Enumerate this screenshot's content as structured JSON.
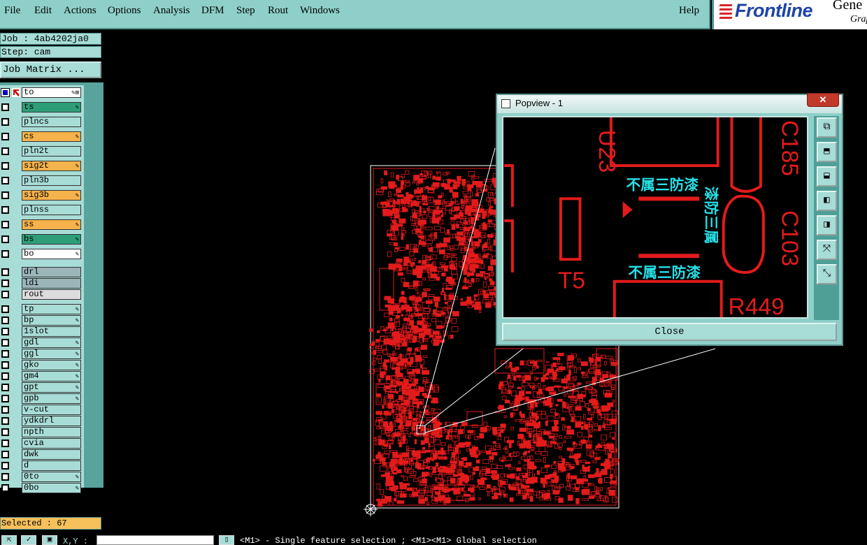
{
  "menu": {
    "items": [
      "File",
      "Edit",
      "Actions",
      "Options",
      "Analysis",
      "DFM",
      "Step",
      "Rout",
      "Windows"
    ],
    "help": "Help"
  },
  "brand": {
    "name": "Frontline",
    "product": "Gene",
    "sub": "Grap"
  },
  "job": {
    "label": "Job : 4ab4202ja0",
    "step": "Step: cam",
    "matrix_button": "Job Matrix ..."
  },
  "layers": [
    {
      "name": "to",
      "color": "white",
      "tag": "✎⊞"
    },
    {
      "name": "ts",
      "color": "green",
      "tag": "✎"
    },
    {
      "name": "plncs",
      "color": "teal",
      "tag": ""
    },
    {
      "name": "cs",
      "color": "orange",
      "tag": "✎"
    },
    {
      "name": "pln2t",
      "color": "teal",
      "tag": ""
    },
    {
      "name": "sig2t",
      "color": "orange",
      "tag": "✎"
    },
    {
      "name": "pln3b",
      "color": "teal",
      "tag": ""
    },
    {
      "name": "sig3b",
      "color": "orange",
      "tag": "✎"
    },
    {
      "name": "plnss",
      "color": "teal",
      "tag": ""
    },
    {
      "name": "ss",
      "color": "orange",
      "tag": "✎"
    },
    {
      "name": "bs",
      "color": "green",
      "tag": "✎"
    },
    {
      "name": "bo",
      "color": "white",
      "tag": "✎"
    },
    {
      "name": "drl",
      "color": "grey",
      "tag": ""
    },
    {
      "name": "ldi",
      "color": "grey",
      "tag": ""
    },
    {
      "name": "rout",
      "color": "lgrey",
      "tag": ""
    },
    {
      "name": "tp",
      "color": "teal",
      "tag": "✎"
    },
    {
      "name": "bp",
      "color": "teal",
      "tag": "✎"
    },
    {
      "name": "1slot",
      "color": "teal",
      "tag": ""
    },
    {
      "name": "gdl",
      "color": "teal",
      "tag": "✎"
    },
    {
      "name": "ggl",
      "color": "teal",
      "tag": "✎"
    },
    {
      "name": "gko",
      "color": "teal",
      "tag": "✎"
    },
    {
      "name": "gm4",
      "color": "teal",
      "tag": "✎"
    },
    {
      "name": "gpt",
      "color": "teal",
      "tag": "✎"
    },
    {
      "name": "gpb",
      "color": "teal",
      "tag": "✎"
    },
    {
      "name": "v-cut",
      "color": "teal",
      "tag": ""
    },
    {
      "name": "ydkdrl",
      "color": "teal",
      "tag": ""
    },
    {
      "name": "npth",
      "color": "teal",
      "tag": ""
    },
    {
      "name": "cvia",
      "color": "teal",
      "tag": ""
    },
    {
      "name": "dwk",
      "color": "teal",
      "tag": ""
    },
    {
      "name": "d",
      "color": "teal",
      "tag": ""
    },
    {
      "name": "0to",
      "color": "teal",
      "tag": "✎"
    },
    {
      "name": "0bo",
      "color": "teal",
      "tag": "✎"
    }
  ],
  "selected": "Selected : 67",
  "coords": {
    "label": "X,Y :",
    "value": ""
  },
  "status": "<M1> - Single feature selection ; <M1><M1> Global selection",
  "popview": {
    "title": "Popview - 1",
    "close_x": "✕",
    "close_button": "Close",
    "labels": [
      "U23",
      "C185",
      "C103",
      "T5",
      "R449"
    ],
    "cjk_labels": [
      "不属三防漆",
      "不属三防漆",
      "漆防三属"
    ]
  },
  "colors": {
    "trace": "#e31b1b",
    "cjk": "#26e0e8",
    "panel": "#8ecfc9"
  }
}
